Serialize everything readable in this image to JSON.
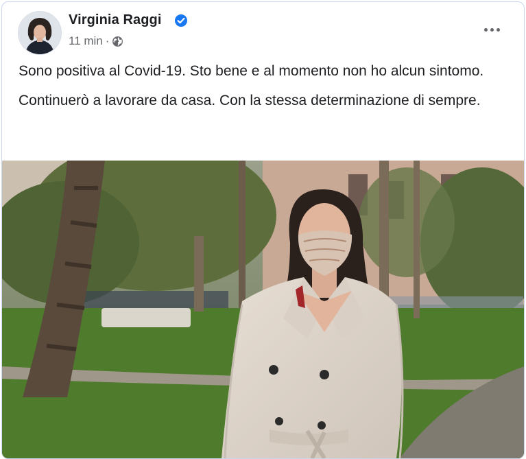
{
  "post": {
    "author": "Virginia Raggi",
    "timestamp": "11 min",
    "separator": "·",
    "verified_icon": "verified-badge-icon",
    "audience_icon": "globe-icon",
    "menu_icon": "more-options-icon",
    "paragraphs": [
      "Sono positiva al Covid-19. Sto bene e al momento non ho alcun sintomo.",
      "Continuerò a lavorare da casa. Con la stessa determinazione di sempre."
    ]
  },
  "colors": {
    "verified": "#1877f2",
    "text": "#1c1e21",
    "secondary": "#65676b"
  }
}
